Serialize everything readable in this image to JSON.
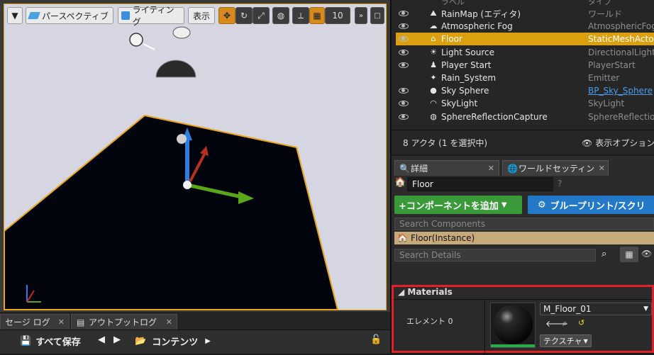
{
  "viewport": {
    "menu_label": "▼",
    "perspective_label": "パースペクティブ",
    "lighting_label": "ライティング",
    "show_label": "表示",
    "grid_value": "10"
  },
  "bottom_tabs": {
    "message_log": "セージ ログ",
    "output_log": "アウトプットログ"
  },
  "content_toolbar": {
    "save_all": "すべて保存",
    "content": "コンテンツ"
  },
  "outliner": {
    "header_name": "ラベル",
    "header_type": "タイプ",
    "rows": [
      {
        "label": "RainMap (エディタ)",
        "type": "ワールド",
        "icon": "world-icon"
      },
      {
        "label": "Atmospheric Fog",
        "type": "AtmosphericFog",
        "icon": "fog-icon"
      },
      {
        "label": "Floor",
        "type": "StaticMeshActor",
        "icon": "house-icon",
        "selected": true
      },
      {
        "label": "Light Source",
        "type": "DirectionalLight",
        "icon": "light-icon"
      },
      {
        "label": "Player Start",
        "type": "PlayerStart",
        "icon": "player-icon"
      },
      {
        "label": "Rain_System",
        "type": "Emitter",
        "icon": "emitter-icon"
      },
      {
        "label": "Sky Sphere",
        "type": "BP_Sky_Sphere",
        "icon": "sphere-icon"
      },
      {
        "label": "SkyLight",
        "type": "SkyLight",
        "icon": "skylight-icon"
      },
      {
        "label": "SphereReflectionCapture",
        "type": "SphereReflectionC",
        "icon": "reflection-icon"
      }
    ],
    "status": "8 アクタ (1 を選択中)",
    "view_options": "表示オプション"
  },
  "details": {
    "tab_details": "詳細",
    "tab_world": "ワールドセッティン",
    "actor_name": "Floor",
    "add_component": "+コンポーネントを追加",
    "blueprint": "ブループリント/スクリ",
    "search_components_placeholder": "Search Components",
    "instance_label": "Floor(Instance)",
    "search_details_placeholder": "Search Details",
    "materials_header": "Materials",
    "element_label": "エレメント 0",
    "material_name": "M_Floor_01",
    "texture_button": "テクスチャ"
  },
  "colors": {
    "selection": "#dba010",
    "highlight_box": "#e0212a",
    "add_button": "#3a9a3a",
    "blueprint_button": "#2478c8"
  }
}
